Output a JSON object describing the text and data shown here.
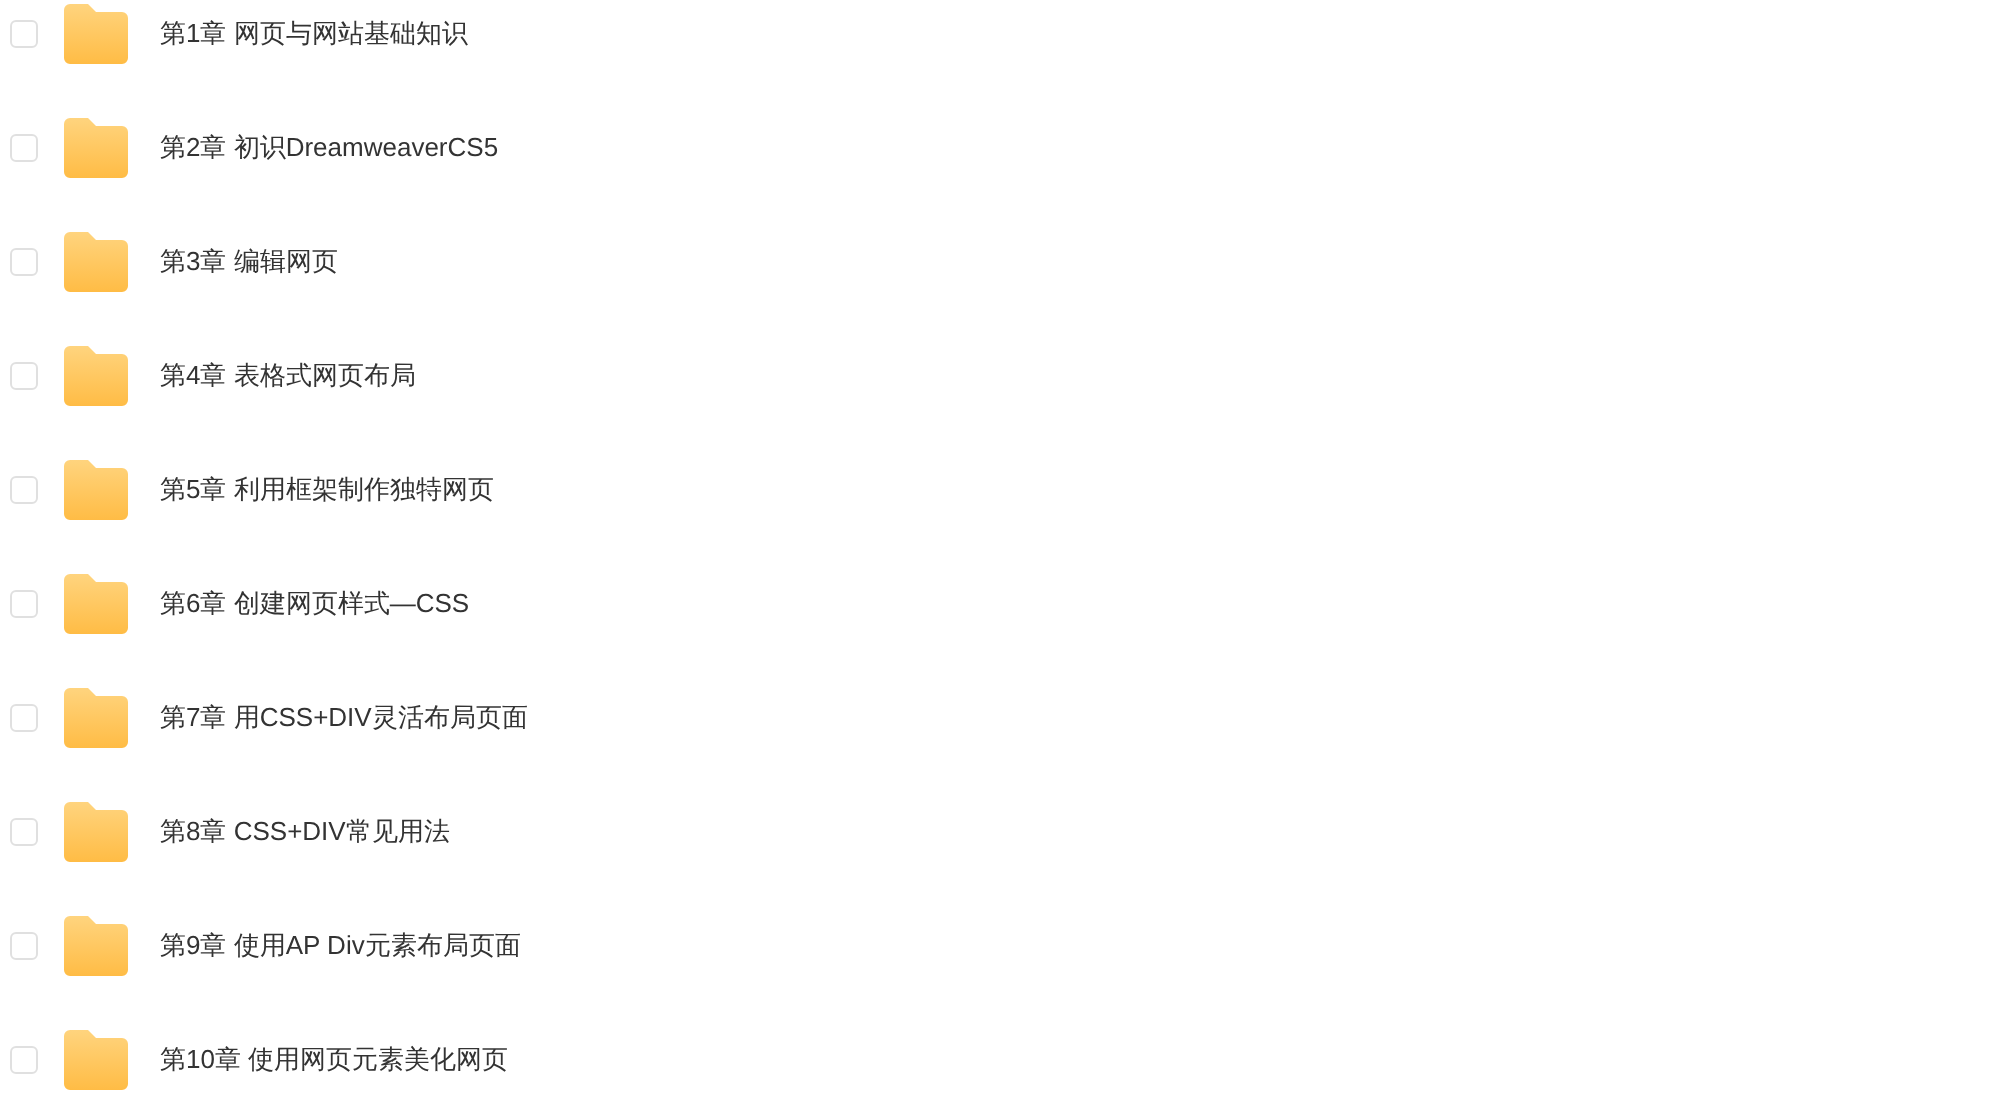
{
  "folders": [
    {
      "name": "第1章 网页与网站基础知识",
      "checked": false
    },
    {
      "name": "第2章 初识DreamweaverCS5",
      "checked": false
    },
    {
      "name": "第3章 编辑网页",
      "checked": false
    },
    {
      "name": "第4章 表格式网页布局",
      "checked": false
    },
    {
      "name": "第5章 利用框架制作独特网页",
      "checked": false
    },
    {
      "name": "第6章 创建网页样式—CSS",
      "checked": false
    },
    {
      "name": "第7章 用CSS+DIV灵活布局页面",
      "checked": false
    },
    {
      "name": "第8章 CSS+DIV常见用法",
      "checked": false
    },
    {
      "name": "第9章 使用AP Div元素布局页面",
      "checked": false
    },
    {
      "name": "第10章 使用网页元素美化网页",
      "checked": false
    }
  ]
}
